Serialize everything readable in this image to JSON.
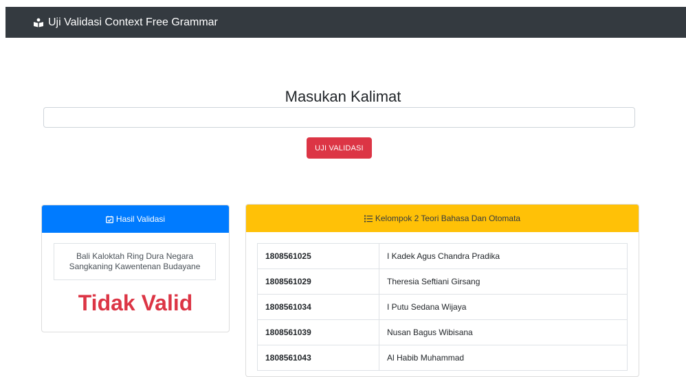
{
  "navbar": {
    "title": "Uji Validasi Context Free Grammar",
    "icon": "reading-person-icon"
  },
  "form": {
    "heading": "Masukan Kalimat",
    "input_value": "",
    "button_label": "UJI VALIDASI"
  },
  "result_card": {
    "header": "Hasil Validasi",
    "icon": "calendar-check-icon",
    "sentence": "Bali Kaloktah Ring Dura Negara Sangkaning Kawentenan Budayane",
    "verdict": "Tidak Valid"
  },
  "group_card": {
    "header": "Kelompok 2 Teori Bahasa Dan Otomata",
    "icon": "list-icon",
    "members": [
      {
        "nim": "1808561025",
        "name": "I Kadek Agus Chandra Pradika"
      },
      {
        "nim": "1808561029",
        "name": "Theresia Seftiani Girsang"
      },
      {
        "nim": "1808561034",
        "name": "I Putu Sedana Wijaya"
      },
      {
        "nim": "1808561039",
        "name": "Nusan Bagus Wibisana"
      },
      {
        "nim": "1808561043",
        "name": "Al Habib Muhammad"
      }
    ]
  },
  "colors": {
    "navbar": "#343a40",
    "danger": "#dc3545",
    "primary": "#007bff",
    "warning": "#ffc107"
  }
}
